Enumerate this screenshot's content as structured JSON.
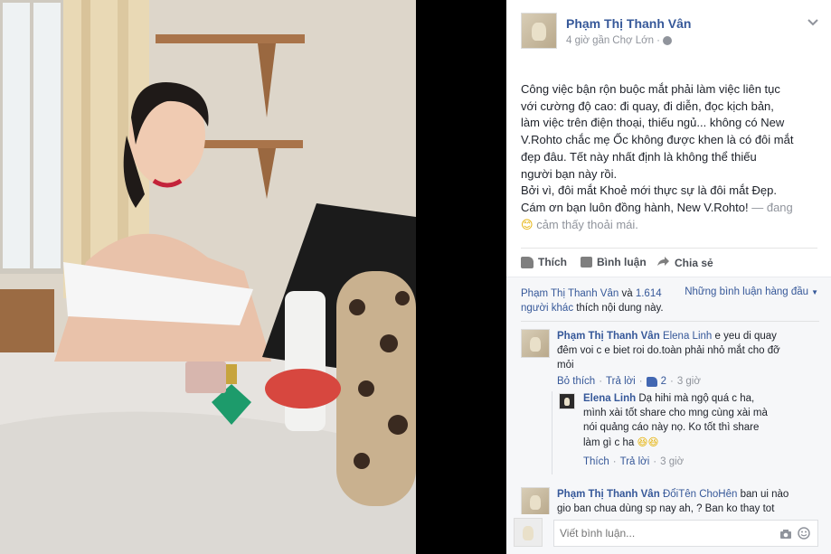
{
  "post": {
    "author": "Phạm Thị Thanh Vân",
    "time": "4 giờ",
    "location_prefix": "gần",
    "location": "Chợ Lớn",
    "body_lines": [
      "Công việc bận rộn buộc mắt phải làm việc liên tục",
      "với cường độ cao: đi quay, đi diễn, đọc kịch bản,",
      "làm việc trên điện thoại, thiếu ngủ... không có New",
      "V.Rohto chắc mẹ Ốc không được khen là có đôi mắt",
      "đẹp đâu. Tết này nhất định là không thể thiếu",
      "người bạn này rồi.",
      "Bởi vì, đôi mắt Khoẻ mới thực sự là đôi mắt Đẹp.",
      "Cám ơn bạn luôn đồng hành, New V.Rohto!"
    ],
    "feeling_prefix": "— đang",
    "feeling": "cảm thấy thoải mái.",
    "feeling_emoji": "😊"
  },
  "actions": {
    "like": "Thích",
    "comment": "Bình luận",
    "share": "Chia sẻ"
  },
  "likes_summary": {
    "name": "Phạm Thị Thanh Vân",
    "and": "và",
    "others": "1.614 người khác",
    "suffix": "thích nội dung này.",
    "sort": "Những bình luận hàng đầu"
  },
  "comments": [
    {
      "author": "Phạm Thị Thanh Vân",
      "mention": "Elena Linh",
      "text_lines": [
        "e yeu di quay",
        "đêm voi c e biet roi do.toàn phải nhỏ mắt cho đỡ",
        "mỏi"
      ],
      "actions": {
        "unlike": "Bỏ thích",
        "reply": "Trả lời",
        "likes": "2",
        "time": "3 giờ"
      }
    },
    {
      "author": "Elena Linh",
      "text_lines": [
        "Dạ hihi mà ngộ quá c ha,",
        "mình xài tốt share cho mng cùng xài mà",
        "nói quảng cáo này nọ. Ko tốt thì share",
        "làm gì c ha"
      ],
      "emoji": "😆😆",
      "actions": {
        "like": "Thích",
        "reply": "Trả lời",
        "time": "3 giờ"
      }
    },
    {
      "author": "Phạm Thị Thanh Vân",
      "mention": "ĐổiTên ChoHên",
      "text_lines": [
        "ban ui nào",
        "gio ban chua dùng sp nay ah, ? Ban ko thay tot"
      ]
    }
  ],
  "comment_input": {
    "placeholder": "Viết bình luận..."
  },
  "icons": {
    "chevron": "chevron-down-icon",
    "globe": "globe-icon",
    "like": "thumbs-up-icon",
    "comment": "comment-icon",
    "share": "share-icon",
    "camera": "camera-icon",
    "sticker": "emoji-icon"
  },
  "colors": {
    "link": "#365899",
    "muted": "#90949c",
    "divider": "#e9ebee"
  }
}
